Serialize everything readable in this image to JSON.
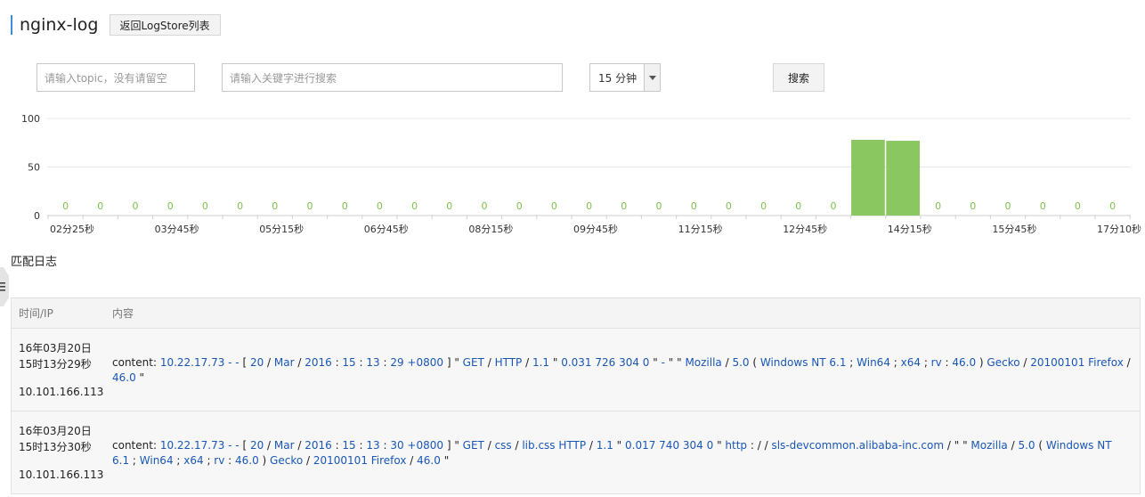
{
  "header": {
    "title": "nginx-log",
    "back_label": "返回LogStore列表"
  },
  "search": {
    "topic_placeholder": "请输入topic，没有请留空",
    "keyword_placeholder": "请输入关键字进行搜索",
    "time_range": "15 分钟",
    "search_label": "搜索"
  },
  "chart_data": {
    "type": "bar",
    "ylim": [
      0,
      100
    ],
    "yticks": [
      0,
      50,
      100
    ],
    "bar_labels": [
      "0",
      "0",
      "0",
      "0",
      "0",
      "0",
      "0",
      "0",
      "0",
      "0",
      "0",
      "0",
      "0",
      "0",
      "0",
      "0",
      "0",
      "0",
      "0",
      "0",
      "0",
      "0",
      "0",
      "0",
      "0",
      "0",
      "0",
      "0",
      "0",
      "0",
      "0"
    ],
    "values": [
      0,
      0,
      0,
      0,
      0,
      0,
      0,
      0,
      0,
      0,
      0,
      0,
      0,
      0,
      0,
      0,
      0,
      0,
      0,
      0,
      0,
      0,
      0,
      78,
      77,
      0,
      0,
      0,
      0,
      0,
      0,
      0,
      0
    ],
    "xtick_labels": [
      "02分25秒",
      "03分45秒",
      "05分15秒",
      "06分45秒",
      "08分15秒",
      "09分45秒",
      "11分15秒",
      "12分45秒",
      "14分15秒",
      "15分45秒",
      "17分10秒"
    ],
    "bar_color": "#8bc760",
    "zero_label_color": "#7dc24e"
  },
  "section_title": "匹配日志",
  "table": {
    "col_time": "时间/IP",
    "col_content": "内容",
    "rows": [
      {
        "date": "16年03月20日",
        "time": "15时13分29秒",
        "ip": "10.101.166.113",
        "prefix": "content:",
        "tokens": [
          {
            "t": "10.22.17.73 - -",
            "h": 1
          },
          {
            "t": " [ ",
            "h": 0
          },
          {
            "t": "20",
            "h": 1
          },
          {
            "t": " / ",
            "h": 0
          },
          {
            "t": "Mar",
            "h": 1
          },
          {
            "t": " / ",
            "h": 0
          },
          {
            "t": "2016",
            "h": 1
          },
          {
            "t": " : ",
            "h": 0
          },
          {
            "t": "15",
            "h": 1
          },
          {
            "t": " : ",
            "h": 0
          },
          {
            "t": "13",
            "h": 1
          },
          {
            "t": " : ",
            "h": 0
          },
          {
            "t": "29 +0800",
            "h": 1
          },
          {
            "t": " ] \" ",
            "h": 0
          },
          {
            "t": "GET",
            "h": 1
          },
          {
            "t": " / ",
            "h": 0
          },
          {
            "t": "HTTP",
            "h": 1
          },
          {
            "t": " / ",
            "h": 0
          },
          {
            "t": "1.1",
            "h": 1
          },
          {
            "t": " \" ",
            "h": 0
          },
          {
            "t": "0.031 726 304 0",
            "h": 1
          },
          {
            "t": " \" ",
            "h": 0
          },
          {
            "t": "-",
            "h": 1
          },
          {
            "t": " \" \" ",
            "h": 0
          },
          {
            "t": "Mozilla",
            "h": 1
          },
          {
            "t": " / ",
            "h": 0
          },
          {
            "t": "5.0",
            "h": 1
          },
          {
            "t": " ( ",
            "h": 0
          },
          {
            "t": "Windows NT 6.1",
            "h": 1
          },
          {
            "t": " ; ",
            "h": 0
          },
          {
            "t": "Win64",
            "h": 1
          },
          {
            "t": " ; ",
            "h": 0
          },
          {
            "t": "x64",
            "h": 1
          },
          {
            "t": " ; ",
            "h": 0
          },
          {
            "t": "rv",
            "h": 1
          },
          {
            "t": " : ",
            "h": 0
          },
          {
            "t": "46.0",
            "h": 1
          },
          {
            "t": " ) ",
            "h": 0
          },
          {
            "t": "Gecko",
            "h": 1
          },
          {
            "t": " / ",
            "h": 0
          },
          {
            "t": "20100101 Firefox",
            "h": 1
          },
          {
            "t": " / ",
            "h": 0
          },
          {
            "t": "46.0",
            "h": 1
          },
          {
            "t": " \"",
            "h": 0
          }
        ]
      },
      {
        "date": "16年03月20日",
        "time": "15时13分30秒",
        "ip": "10.101.166.113",
        "prefix": "content:",
        "tokens": [
          {
            "t": "10.22.17.73 - -",
            "h": 1
          },
          {
            "t": " [ ",
            "h": 0
          },
          {
            "t": "20",
            "h": 1
          },
          {
            "t": " / ",
            "h": 0
          },
          {
            "t": "Mar",
            "h": 1
          },
          {
            "t": " / ",
            "h": 0
          },
          {
            "t": "2016",
            "h": 1
          },
          {
            "t": " : ",
            "h": 0
          },
          {
            "t": "15",
            "h": 1
          },
          {
            "t": " : ",
            "h": 0
          },
          {
            "t": "13",
            "h": 1
          },
          {
            "t": " : ",
            "h": 0
          },
          {
            "t": "30 +0800",
            "h": 1
          },
          {
            "t": " ] \" ",
            "h": 0
          },
          {
            "t": "GET",
            "h": 1
          },
          {
            "t": " / ",
            "h": 0
          },
          {
            "t": "css",
            "h": 1
          },
          {
            "t": " / ",
            "h": 0
          },
          {
            "t": "lib.css HTTP",
            "h": 1
          },
          {
            "t": " / ",
            "h": 0
          },
          {
            "t": "1.1",
            "h": 1
          },
          {
            "t": " \" ",
            "h": 0
          },
          {
            "t": "0.017 740 304 0",
            "h": 1
          },
          {
            "t": " \" ",
            "h": 0
          },
          {
            "t": "http",
            "h": 1
          },
          {
            "t": " : / / ",
            "h": 0
          },
          {
            "t": "sls-devcommon.alibaba-inc.com",
            "h": 1
          },
          {
            "t": " / \" \" ",
            "h": 0
          },
          {
            "t": "Mozilla",
            "h": 1
          },
          {
            "t": " / ",
            "h": 0
          },
          {
            "t": "5.0",
            "h": 1
          },
          {
            "t": " ( ",
            "h": 0
          },
          {
            "t": "Windows NT 6.1",
            "h": 1
          },
          {
            "t": " ; ",
            "h": 0
          },
          {
            "t": "Win64",
            "h": 1
          },
          {
            "t": " ; ",
            "h": 0
          },
          {
            "t": "x64",
            "h": 1
          },
          {
            "t": " ; ",
            "h": 0
          },
          {
            "t": "rv",
            "h": 1
          },
          {
            "t": " : ",
            "h": 0
          },
          {
            "t": "46.0",
            "h": 1
          },
          {
            "t": " ) ",
            "h": 0
          },
          {
            "t": "Gecko",
            "h": 1
          },
          {
            "t": " / ",
            "h": 0
          },
          {
            "t": "20100101 Firefox",
            "h": 1
          },
          {
            "t": " / ",
            "h": 0
          },
          {
            "t": "46.0",
            "h": 1
          },
          {
            "t": " \"",
            "h": 0
          }
        ]
      }
    ]
  }
}
